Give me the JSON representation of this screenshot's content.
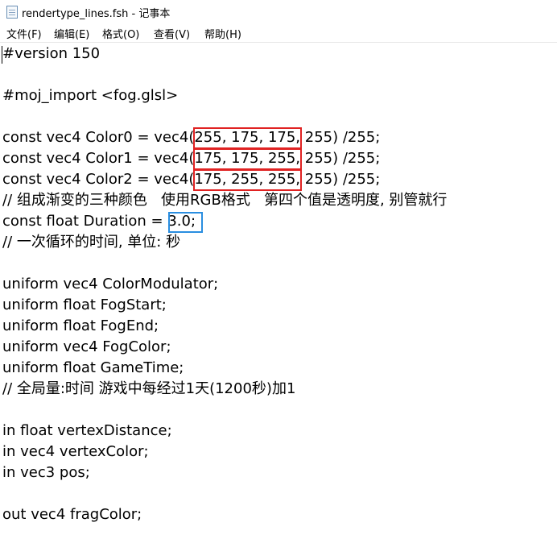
{
  "window": {
    "title": "rendertype_lines.fsh - 记事本",
    "icon": "notepad-icon"
  },
  "menu": {
    "file": "文件(F)",
    "edit": "编辑(E)",
    "format": "格式(O)",
    "view": "查看(V)",
    "help": "帮助(H)"
  },
  "editor": {
    "lines": [
      "#version 150",
      "",
      "#moj_import <fog.glsl>",
      "",
      "const vec4 Color0 = vec4(255, 175, 175, 255) /255;",
      "const vec4 Color1 = vec4(175, 175, 255, 255) /255;",
      "const vec4 Color2 = vec4(175, 255, 255, 255) /255;",
      "// 组成渐变的三种颜色   使用RGB格式   第四个值是透明度, 别管就行",
      "const float Duration = 3.0;",
      "// 一次循环的时间, 单位: 秒",
      "",
      "uniform vec4 ColorModulator;",
      "uniform float FogStart;",
      "uniform float FogEnd;",
      "uniform vec4 FogColor;",
      "uniform float GameTime;",
      "// 全局量:时间 游戏中每经过1天(1200秒)加1",
      "",
      "in float vertexDistance;",
      "in vec4 vertexColor;",
      "in vec3 pos;",
      "",
      "out vec4 fragColor;"
    ]
  },
  "annotations": {
    "red_color": "#e02222",
    "blue_color": "#2a8ee0"
  }
}
